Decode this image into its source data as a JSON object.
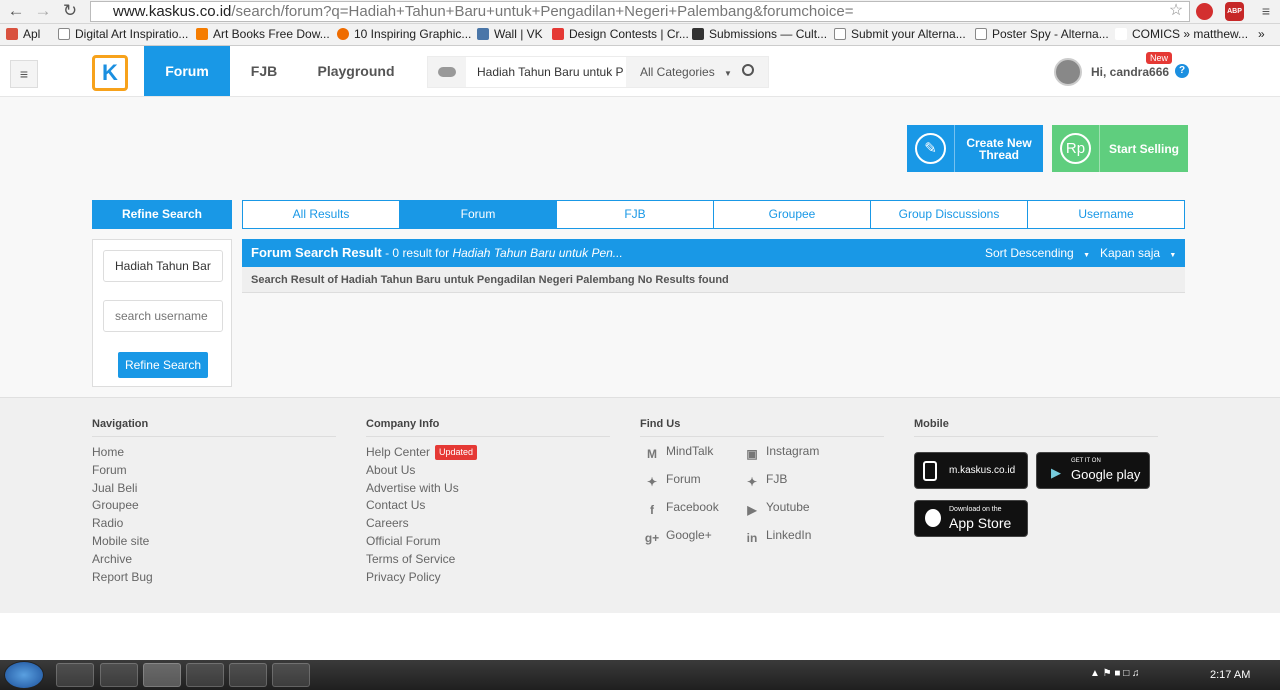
{
  "browser": {
    "url_domain": "www.kaskus.co.id",
    "url_path": "/search/forum?q=Hadiah+Tahun+Baru+untuk+Pengadilan+Negeri+Palembang&forumchoice=",
    "bookmarks": [
      "Apl",
      "Digital Art Inspiratio...",
      "Art Books Free Dow...",
      "10 Inspiring Graphic...",
      "Wall | VK",
      "Design Contests | Cr...",
      "Submissions — Cult...",
      "Submit your Alterna...",
      "Poster Spy - Alterna...",
      "COMICS » matthew..."
    ],
    "abp": "ABP"
  },
  "header": {
    "logo": "K",
    "nav": [
      "Forum",
      "FJB",
      "Playground"
    ],
    "search_value": "Hadiah Tahun Baru untuk P",
    "category": "All Categories",
    "greeting": "Hi, candra666",
    "new_badge": "New",
    "help": "?"
  },
  "actions": {
    "create_label": "Create New Thread",
    "sell_label": "Start Selling",
    "sell_icon": "Rp"
  },
  "refine": {
    "heading": "Refine Search",
    "query_value": "Hadiah Tahun Bar",
    "username_placeholder": "search username",
    "button": "Refine Search"
  },
  "tabs": [
    "All Results",
    "Forum",
    "FJB",
    "Groupee",
    "Group Discussions",
    "Username"
  ],
  "results": {
    "title": "Forum Search Result",
    "summary": " - 0 result for ",
    "query": "Hadiah Tahun Baru untuk Pen...",
    "sort": "Sort Descending",
    "time": "Kapan saja",
    "message": "Search Result of Hadiah Tahun Baru untuk Pengadilan Negeri Palembang No Results found"
  },
  "footer": {
    "navigation": {
      "heading": "Navigation",
      "links": [
        "Home",
        "Forum",
        "Jual Beli",
        "Groupee",
        "Radio",
        "Mobile site",
        "Archive",
        "Report Bug"
      ]
    },
    "company": {
      "heading": "Company Info",
      "links": [
        "Help Center",
        "About Us",
        "Advertise with Us",
        "Contact Us",
        "Careers",
        "Official Forum",
        "Terms of Service",
        "Privacy Policy"
      ],
      "updated_badge": "Updated"
    },
    "find": {
      "heading": "Find Us",
      "links": [
        "MindTalk",
        "Instagram",
        "Forum",
        "FJB",
        "Facebook",
        "Youtube",
        "Google+",
        "LinkedIn"
      ]
    },
    "mobile": {
      "heading": "Mobile",
      "mobile_site": "m.kaskus.co.id",
      "gp_small": "GET IT ON",
      "gp_big": "Google play",
      "as_small": "Download on the",
      "as_big": "App Store"
    }
  },
  "taskbar": {
    "clock": "2:17 AM"
  },
  "colors": {
    "brand_blue": "#1998e6",
    "sell_green": "#5fce7e",
    "logo_orange": "#f7a21b"
  }
}
